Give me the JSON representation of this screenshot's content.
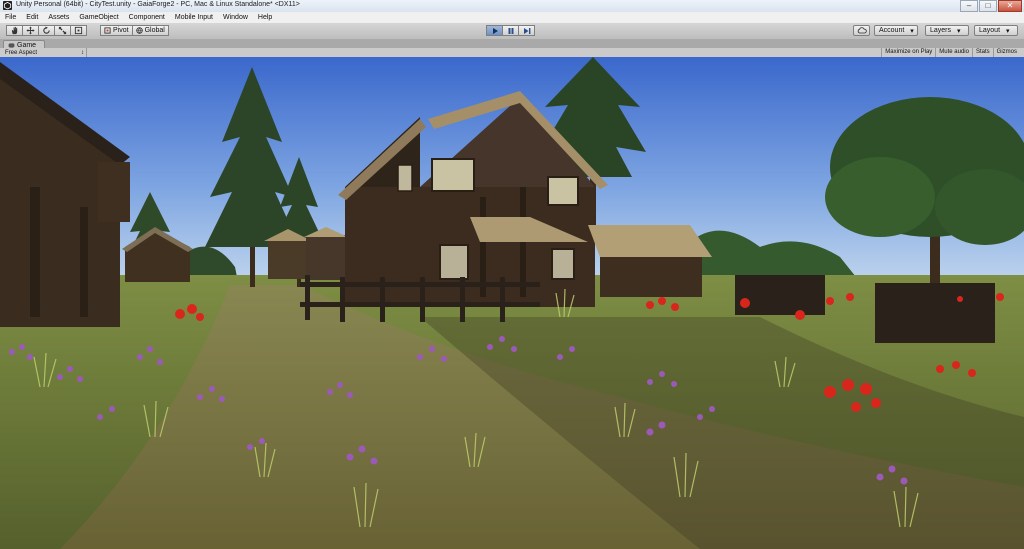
{
  "window": {
    "title": "Unity Personal (64bit) - CityTest.unity - GaiaForge2 - PC, Mac & Linux Standalone* <DX11>",
    "controls": {
      "minimize": "–",
      "maximize": "□",
      "close": "✕"
    }
  },
  "menu": [
    "File",
    "Edit",
    "Assets",
    "GameObject",
    "Component",
    "Mobile Input",
    "Window",
    "Help"
  ],
  "toolbar": {
    "pivot_label": "Pivot",
    "global_label": "Global",
    "account_label": "Account",
    "layers_label": "Layers",
    "layout_label": "Layout",
    "dropdown_arrow": "▾"
  },
  "tabs": {
    "game": "Game"
  },
  "game_view": {
    "aspect": "Free Aspect",
    "aspect_arrow": "↕",
    "options": [
      "Maximize on Play",
      "Mute audio",
      "Stats",
      "Gizmos"
    ]
  },
  "colors": {
    "sky_top": "#3f6fd0",
    "sky_bottom": "#b9d4ee",
    "grass": "#6d7f3d",
    "path": "#8a7a4f",
    "wood": "#3b2d20",
    "roof": "#b39a6e",
    "flower_red": "#d9261c",
    "flower_purple": "#9b5ab8",
    "play_active": "#6f92c4"
  }
}
